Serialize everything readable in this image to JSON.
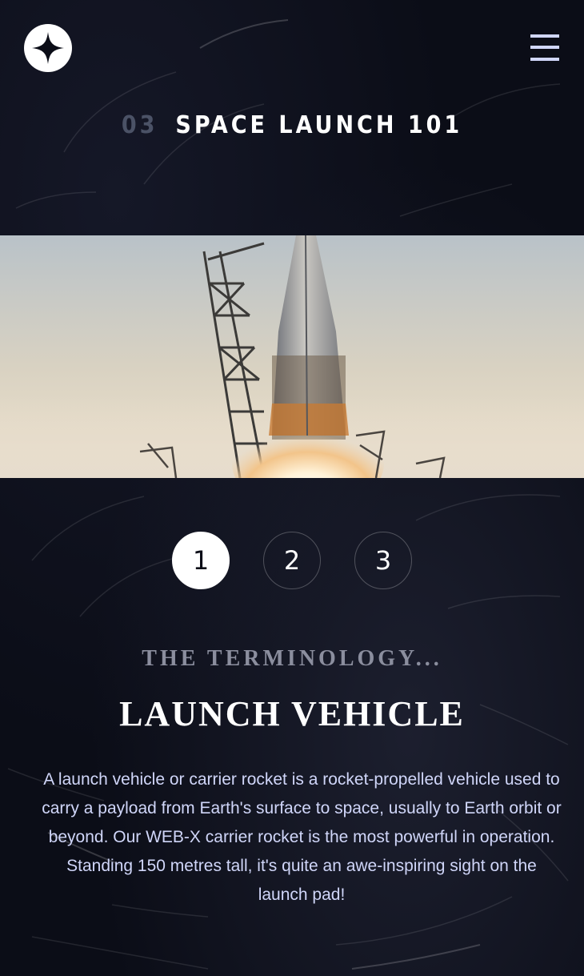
{
  "header": {
    "logo_icon": "star-logo-icon",
    "menu_icon": "hamburger-menu-icon"
  },
  "page": {
    "number": "03",
    "title": "SPACE LAUNCH 101"
  },
  "hero_image": "rocket-launch-photo",
  "pager": {
    "items": [
      "1",
      "2",
      "3"
    ],
    "active": 1
  },
  "content": {
    "subheading": "THE TERMINOLOGY...",
    "term": "LAUNCH VEHICLE",
    "description": "A launch vehicle or carrier rocket is a rocket-propelled vehicle used to carry a payload from Earth's surface to space, usually to Earth orbit or beyond. Our WEB-X carrier rocket is the most powerful in operation. Standing 150 metres tall, it's quite an awe-inspiring sight on the launch pad!"
  },
  "colors": {
    "background": "#0b0d17",
    "accent": "#d0d6f9",
    "muted": "#4b5266",
    "white": "#ffffff"
  }
}
